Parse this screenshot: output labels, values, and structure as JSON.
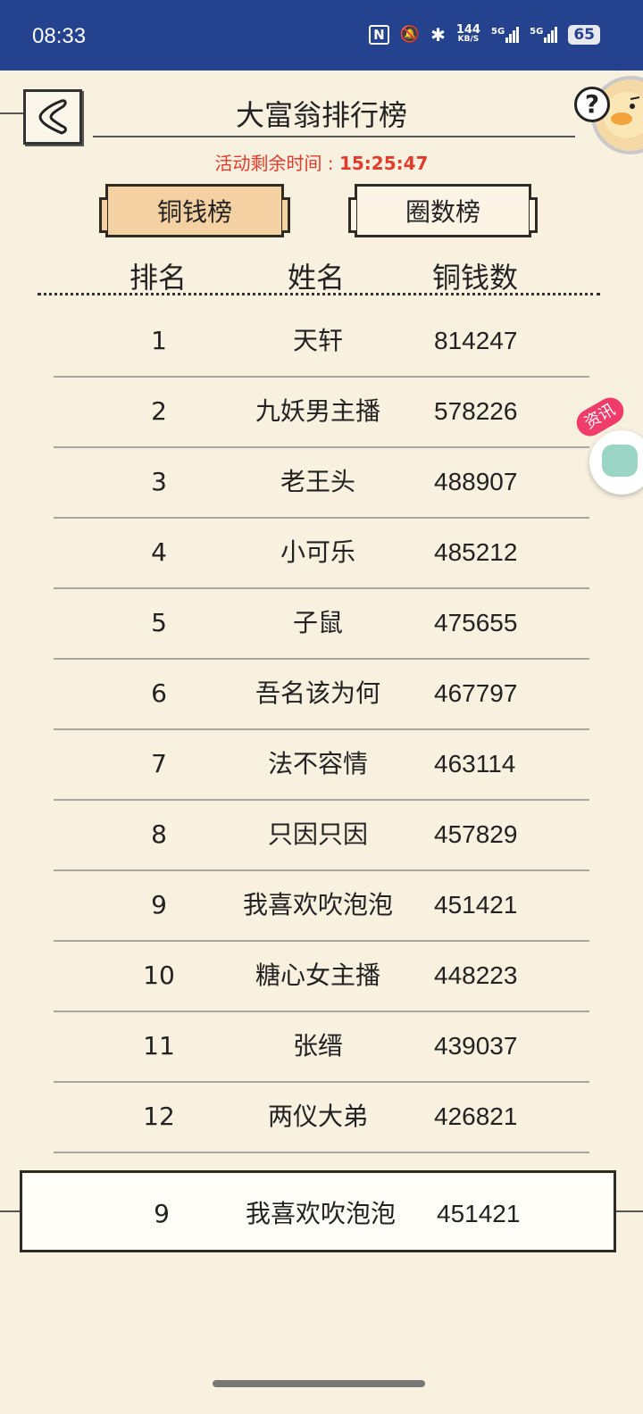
{
  "status": {
    "time": "08:33",
    "nfc_icon": "N",
    "mute_icon": "🔕",
    "bluetooth_icon": "✱",
    "net_speed_top": "144",
    "net_speed_unit": "KB/S",
    "sim1": "5G",
    "sim2": "5G",
    "battery": "65"
  },
  "header": {
    "title": "大富翁排行榜",
    "countdown_label": "活动剩余时间 : ",
    "countdown_value": "15:25:47",
    "help": "?"
  },
  "tabs": [
    {
      "label": "铜钱榜",
      "active": true
    },
    {
      "label": "圈数榜",
      "active": false
    }
  ],
  "table": {
    "headers": {
      "rank": "排名",
      "name": "姓名",
      "coins": "铜钱数"
    },
    "rows": [
      {
        "rank": "1",
        "name": "天轩",
        "coins": "814247"
      },
      {
        "rank": "2",
        "name": "九妖男主播",
        "coins": "578226"
      },
      {
        "rank": "3",
        "name": "老王头",
        "coins": "488907"
      },
      {
        "rank": "4",
        "name": "小可乐",
        "coins": "485212"
      },
      {
        "rank": "5",
        "name": "子鼠",
        "coins": "475655"
      },
      {
        "rank": "6",
        "name": "吾名该为何",
        "coins": "467797"
      },
      {
        "rank": "7",
        "name": "法不容情",
        "coins": "463114"
      },
      {
        "rank": "8",
        "name": "只因只因",
        "coins": "457829"
      },
      {
        "rank": "9",
        "name": "我喜欢吹泡泡",
        "coins": "451421"
      },
      {
        "rank": "10",
        "name": "糖心女主播",
        "coins": "448223"
      },
      {
        "rank": "11",
        "name": "张缙",
        "coins": "439037"
      },
      {
        "rank": "12",
        "name": "两仪大弟",
        "coins": "426821"
      }
    ]
  },
  "my_rank": {
    "rank": "9",
    "name": "我喜欢吹泡泡",
    "coins": "451421"
  },
  "news_widget": {
    "label": "资讯"
  },
  "colors": {
    "status_bar": "#24428e",
    "background": "#f8f1e0",
    "active_tab": "#f4d1a2",
    "countdown": "#e23a2b"
  }
}
